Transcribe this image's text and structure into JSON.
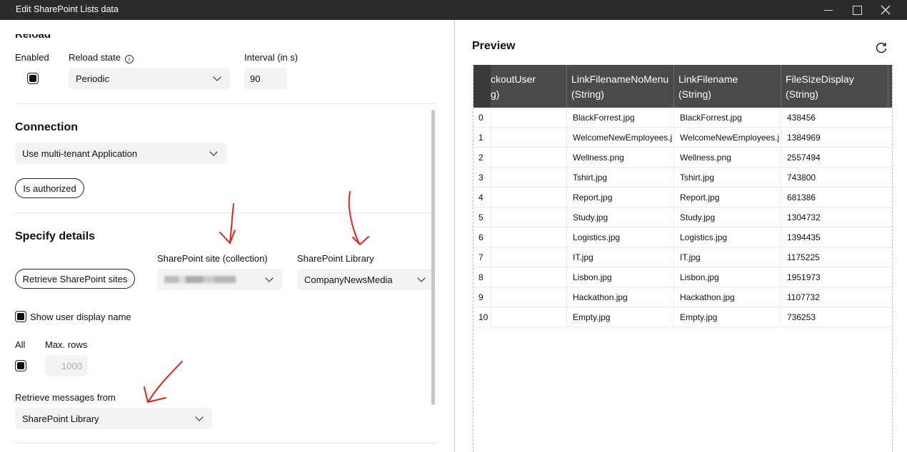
{
  "window": {
    "title": "Edit SharePoint Lists data"
  },
  "reload": {
    "heading": "Reload",
    "enabled_label": "Enabled",
    "state_label": "Reload state",
    "state_value": "Periodic",
    "interval_label": "Interval (in s)",
    "interval_value": "90"
  },
  "connection": {
    "heading": "Connection",
    "mode_value": "Use multi-tenant Application",
    "auth_button": "Is authorized"
  },
  "details": {
    "heading": "Specify details",
    "retrieve_sites_button": "Retrieve SharePoint sites",
    "site_label": "SharePoint site (collection)",
    "library_label": "SharePoint Library",
    "library_value": "CompanyNewsMedia",
    "show_user_label": "Show user display name",
    "all_label": "All",
    "max_rows_label": "Max. rows",
    "max_rows_value": "1000",
    "retrieve_from_label": "Retrieve messages from",
    "retrieve_from_value": "SharePoint Library"
  },
  "preview": {
    "title": "Preview",
    "columns": [
      {
        "name": "ckoutUser",
        "type": "g)"
      },
      {
        "name": "LinkFilenameNoMenu",
        "type": "(String)"
      },
      {
        "name": "LinkFilename",
        "type": "(String)"
      },
      {
        "name": "FileSizeDisplay",
        "type": "(String)"
      }
    ],
    "rows": [
      {
        "idx": "0",
        "nomenu": "BlackForrest.jpg",
        "file": "BlackForrest.jpg",
        "size": "438456"
      },
      {
        "idx": "1",
        "nomenu": "WelcomeNewEmployees.j",
        "file": "WelcomeNewEmployees.j",
        "size": "1384969"
      },
      {
        "idx": "2",
        "nomenu": "Wellness.png",
        "file": "Wellness.png",
        "size": "2557494"
      },
      {
        "idx": "3",
        "nomenu": "Tshirt.jpg",
        "file": "Tshirt.jpg",
        "size": "743800"
      },
      {
        "idx": "4",
        "nomenu": "Report.jpg",
        "file": "Report.jpg",
        "size": "681386"
      },
      {
        "idx": "5",
        "nomenu": "Study.jpg",
        "file": "Study.jpg",
        "size": "1304732"
      },
      {
        "idx": "6",
        "nomenu": "Logistics.jpg",
        "file": "Logistics.jpg",
        "size": "1394435"
      },
      {
        "idx": "7",
        "nomenu": "IT.jpg",
        "file": "IT.jpg",
        "size": "1175225"
      },
      {
        "idx": "8",
        "nomenu": "Lisbon.jpg",
        "file": "Lisbon.jpg",
        "size": "1951973"
      },
      {
        "idx": "9",
        "nomenu": "Hackathon.jpg",
        "file": "Hackathon.jpg",
        "size": "1107732"
      },
      {
        "idx": "10",
        "nomenu": "Empty.jpg",
        "file": "Empty.jpg",
        "size": "736253"
      }
    ]
  },
  "colors": {
    "titlebar": "#2b2b2b",
    "table_header": "#4a4a4a",
    "annotation": "#e8231b"
  }
}
